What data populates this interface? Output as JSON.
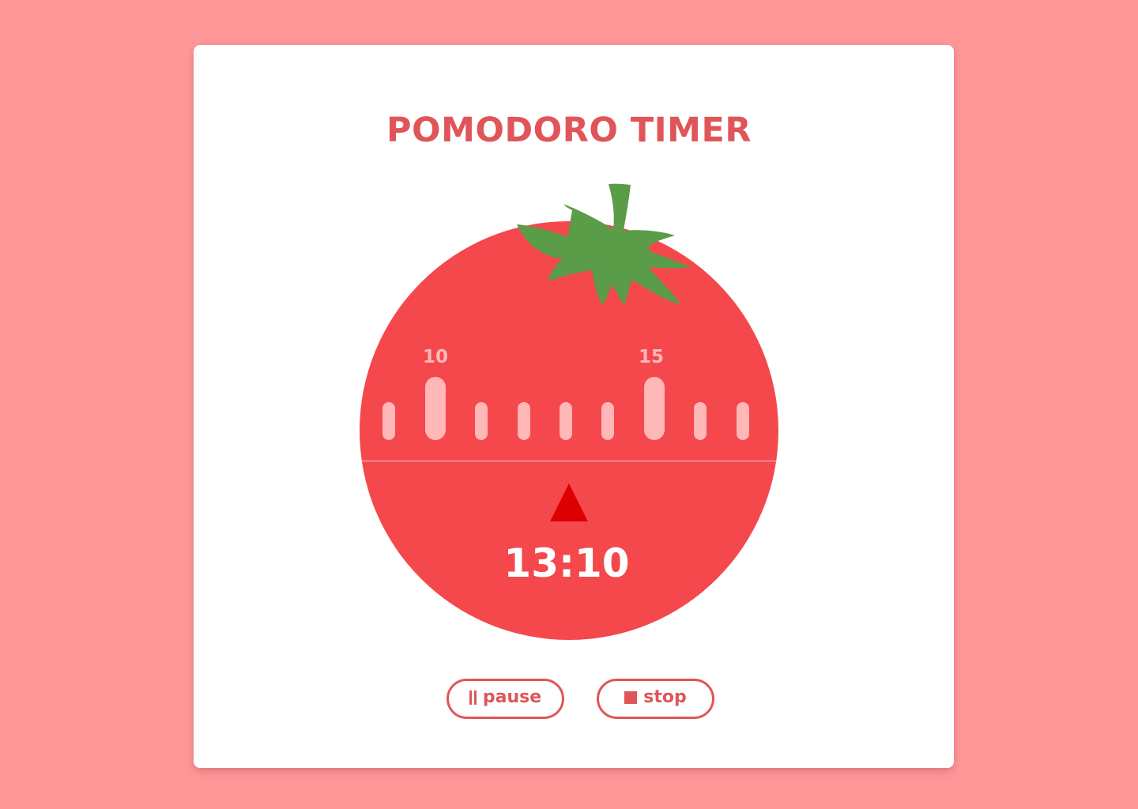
{
  "app": {
    "title": "POMODORO TIMER"
  },
  "timer": {
    "display": "13:10",
    "dial_labels": [
      {
        "value": "10"
      },
      {
        "value": "15"
      }
    ]
  },
  "controls": {
    "pause_label": "pause",
    "stop_label": "stop"
  },
  "colors": {
    "background": "#ff9798",
    "card": "#ffffff",
    "accent": "#e05558",
    "tomato": "#f4484d",
    "leaves": "#5a9c48",
    "ticks": "#ffb7b8",
    "pointer": "#dd0000"
  },
  "icons": {
    "pause": "pause-icon",
    "stop": "stop-icon",
    "pointer": "triangle-pointer-icon",
    "leaves": "tomato-leaves-icon"
  }
}
